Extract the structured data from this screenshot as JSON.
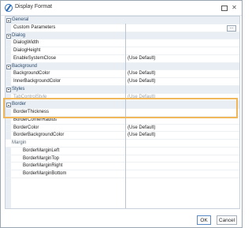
{
  "window": {
    "title": "Display Format",
    "close_glyph": "✕"
  },
  "grid": {
    "categories": {
      "general": "General",
      "dialog": "Dialog",
      "background": "Background",
      "styles": "Styles",
      "border": "Border",
      "margin": "Margin"
    },
    "props": {
      "custom_parameters": {
        "name": "Custom Parameters",
        "value": ""
      },
      "dialog_width": {
        "name": "DialogWidth",
        "value": ""
      },
      "dialog_height": {
        "name": "DialogHeight",
        "value": ""
      },
      "enable_system_close": {
        "name": "EnableSystemClose",
        "value": "(Use Default)"
      },
      "background_color": {
        "name": "BackgroundColor",
        "value": "(Use Default)"
      },
      "inner_background_color": {
        "name": "InnerBackgroundColor",
        "value": "(Use Default)"
      },
      "tab_control_style": {
        "name": "TabControlStyle",
        "value": "(Use Default)"
      },
      "border_thickness": {
        "name": "BorderThickness",
        "value": ""
      },
      "border_corner_radius": {
        "name": "BorderCornerRadius",
        "value": ""
      },
      "border_color": {
        "name": "BorderColor",
        "value": "(Use Default)"
      },
      "border_background_color": {
        "name": "BorderBackgroundColor",
        "value": "(Use Default)"
      },
      "border_margin_left": {
        "name": "BorderMarginLeft",
        "value": ""
      },
      "border_margin_top": {
        "name": "BorderMarginTop",
        "value": ""
      },
      "border_margin_right": {
        "name": "BorderMarginRight",
        "value": ""
      },
      "border_margin_bottom": {
        "name": "BorderMarginBottom",
        "value": ""
      }
    },
    "ellipsis_label": "...",
    "highlight_color": "#f0b85a"
  },
  "footer": {
    "ok_label": "OK",
    "cancel_label": "Cancel"
  }
}
